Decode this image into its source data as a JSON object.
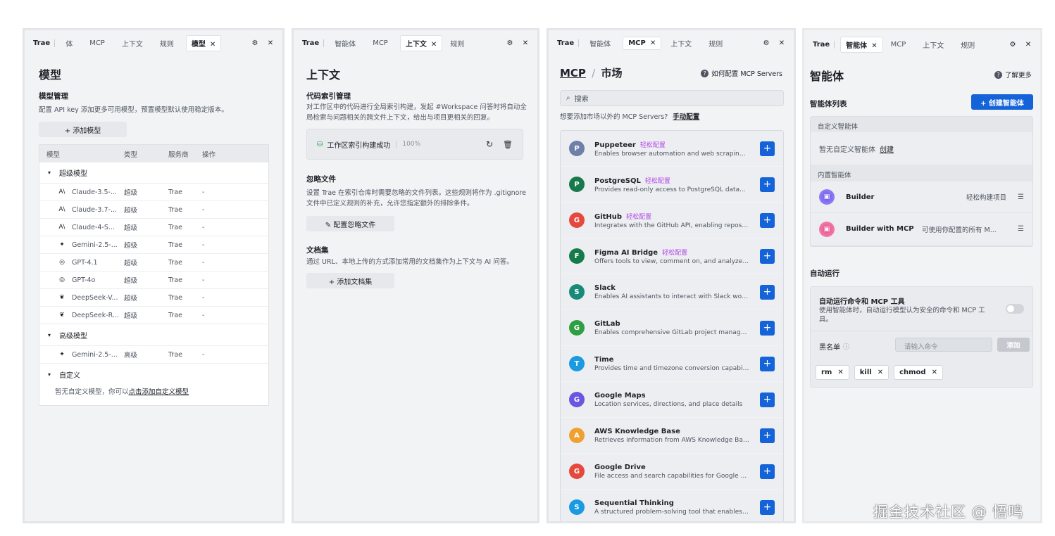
{
  "panel_models": {
    "tabs": [
      "Trae",
      "体",
      "MCP",
      "上下文",
      "规则"
    ],
    "active_tab": "模型",
    "title": "模型",
    "manage_title": "模型管理",
    "manage_desc": "配置 API key 添加更多可用模型，预置模型默认使用稳定版本。",
    "add_button": "+ 添加模型",
    "table_headers": [
      "模型",
      "类型",
      "服务商",
      "操作"
    ],
    "groups": [
      {
        "label": "超级模型",
        "rows": [
          {
            "icon": "A\\",
            "name": "Claude-3.5-...",
            "type": "超级",
            "vendor": "Trae",
            "op": "-"
          },
          {
            "icon": "A\\",
            "name": "Claude-3.7-...",
            "type": "超级",
            "vendor": "Trae",
            "op": "-"
          },
          {
            "icon": "A\\",
            "name": "Claude-4-S...",
            "type": "超级",
            "vendor": "Trae",
            "op": "-"
          },
          {
            "icon": "✦",
            "name": "Gemini-2.5-...",
            "type": "超级",
            "vendor": "Trae",
            "op": "-"
          },
          {
            "icon": "◎",
            "name": "GPT-4.1",
            "type": "超级",
            "vendor": "Trae",
            "op": "-"
          },
          {
            "icon": "◎",
            "name": "GPT-4o",
            "type": "超级",
            "vendor": "Trae",
            "op": "-"
          },
          {
            "icon": "❦",
            "name": "DeepSeek-V...",
            "type": "超级",
            "vendor": "Trae",
            "op": "-"
          },
          {
            "icon": "❦",
            "name": "DeepSeek-R...",
            "type": "超级",
            "vendor": "Trae",
            "op": "-"
          }
        ]
      },
      {
        "label": "高级模型",
        "rows": [
          {
            "icon": "✦",
            "name": "Gemini-2.5-...",
            "type": "高级",
            "vendor": "Trae",
            "op": "-"
          }
        ]
      },
      {
        "label": "自定义",
        "rows": []
      }
    ],
    "custom_empty_prefix": "暂无自定义模型，你可以",
    "custom_empty_link": "点击添加自定义模型"
  },
  "panel_context": {
    "tabs": [
      "Trae",
      "智能体",
      "MCP"
    ],
    "active_tab": "上下文",
    "tab_after": "规则",
    "title": "上下文",
    "index_title": "代码索引管理",
    "index_desc_1": "对工作区中的代码进行全局索引构建，发起 #Workspace 问答时将自动全",
    "index_desc_2": "局检索与问题相关的跨文件上下文，给出与项目更相关的回复。",
    "index_status": "工作区索引构建成功",
    "index_percent": "100%",
    "ignore_title": "忽略文件",
    "ignore_desc_1": "设置 Trae 在索引仓库时需要忽略的文件列表。这些规则将作为 .gitignore",
    "ignore_desc_2": "文件中已定义规则的补充，允许您指定额外的排除条件。",
    "ignore_button": "✎ 配置忽略文件",
    "docs_title": "文档集",
    "docs_desc": "通过 URL、本地上传的方式添加常用的文档集作为上下文与 AI 问答。",
    "docs_button": "+ 添加文档集"
  },
  "panel_mcp": {
    "tabs": [
      "Trae",
      "智能体"
    ],
    "active_tab": "MCP",
    "tab_after": [
      "上下文",
      "规则"
    ],
    "breadcrumb_root": "MCP",
    "breadcrumb_sep": "/",
    "breadcrumb_current": "市场",
    "help_link": "如何配置 MCP Servers",
    "search_placeholder": "搜索",
    "manual_prefix": "想要添加市场以外的 MCP Servers?",
    "manual_link": "手动配置",
    "items": [
      {
        "letter": "P",
        "color": "#6e7fa8",
        "name": "Puppeteer",
        "tag": "轻松配置",
        "desc": "Enables browser automation and web scraping ..."
      },
      {
        "letter": "P",
        "color": "#177a4a",
        "name": "PostgreSQL",
        "tag": "轻松配置",
        "desc": "Provides read-only access to PostgreSQL data..."
      },
      {
        "letter": "G",
        "color": "#e5483c",
        "name": "GitHub",
        "tag": "轻松配置",
        "desc": "Integrates with the GitHub API, enabling reposit..."
      },
      {
        "letter": "F",
        "color": "#177a4a",
        "name": "Figma AI Bridge",
        "tag": "轻松配置",
        "desc": "Offers tools to view, comment on, and analyze ..."
      },
      {
        "letter": "S",
        "color": "#1a8a78",
        "name": "Slack",
        "tag": "",
        "desc": "Enables AI assistants to interact with Slack wor..."
      },
      {
        "letter": "G",
        "color": "#2ea043",
        "name": "GitLab",
        "tag": "",
        "desc": "Enables comprehensive GitLab project manage..."
      },
      {
        "letter": "T",
        "color": "#1a9ae0",
        "name": "Time",
        "tag": "",
        "desc": "Provides time and timezone conversion capabili..."
      },
      {
        "letter": "G",
        "color": "#6c55e0",
        "name": "Google Maps",
        "tag": "",
        "desc": "Location services, directions, and place details"
      },
      {
        "letter": "A",
        "color": "#f0a030",
        "name": "AWS Knowledge Base",
        "tag": "",
        "desc": "Retrieves information from AWS Knowledge Bas..."
      },
      {
        "letter": "G",
        "color": "#e5483c",
        "name": "Google Drive",
        "tag": "",
        "desc": "File access and search capabilities for Google ..."
      },
      {
        "letter": "S",
        "color": "#1a9ae0",
        "name": "Sequential Thinking",
        "tag": "",
        "desc": "A structured problem-solving tool that enables ..."
      }
    ]
  },
  "panel_agents": {
    "tabs": [
      "Trae"
    ],
    "active_tab": "智能体",
    "tab_after": [
      "MCP",
      "上下文",
      "规则"
    ],
    "title": "智能体",
    "learn_more": "了解更多",
    "list_title": "智能体列表",
    "create_button": "+ 创建智能体",
    "custom_header": "自定义智能体",
    "custom_empty": "暂无自定义智能体",
    "custom_create": "创建",
    "builtin_header": "内置智能体",
    "builtin": [
      {
        "name": "Builder",
        "desc": "轻松构建项目"
      },
      {
        "name": "Builder with MCP",
        "desc": "可使用你配置的所有 M..."
      }
    ],
    "auto_title": "自动运行",
    "auto_item_title": "自动运行命令和 MCP 工具",
    "auto_item_desc_1": "使用智能体时，自动运行模型认为安全的命令和 MCP 工",
    "auto_item_desc_2": "具。",
    "blacklist_label": "黑名单",
    "blacklist_placeholder": "请输入命令",
    "blacklist_add": "添加",
    "chips": [
      "rm",
      "kill",
      "chmod"
    ]
  },
  "watermark": "掘金技术社区 @ 悟鸣"
}
